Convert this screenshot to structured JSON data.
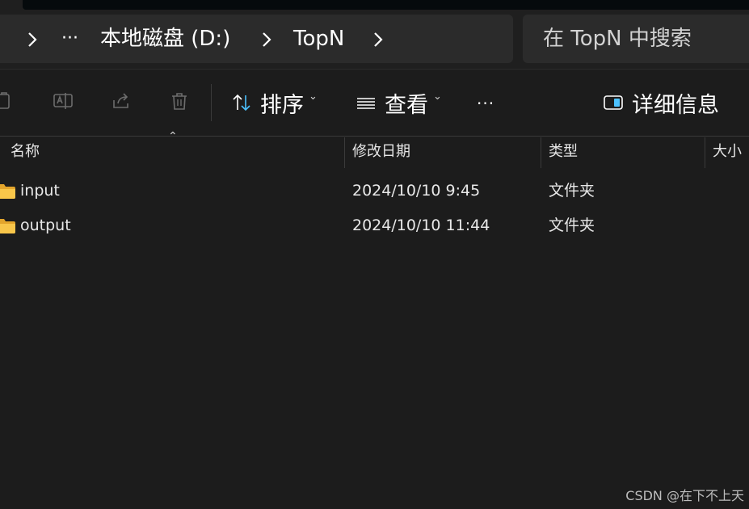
{
  "breadcrumb": {
    "overflow": "···",
    "items": [
      "本地磁盘 (D:)",
      "TopN"
    ]
  },
  "search": {
    "placeholder": "在 TopN 中搜索"
  },
  "command_bar": {
    "copy_icon": "copy-icon",
    "rename_icon": "rename-icon",
    "share_icon": "share-icon",
    "delete_icon": "trash-icon",
    "sort_label": "排序",
    "view_label": "查看",
    "more_label": "···",
    "details_label": "详细信息"
  },
  "columns": {
    "name": "名称",
    "modified": "修改日期",
    "type": "类型",
    "size": "大小"
  },
  "rows": [
    {
      "name": "input",
      "modified": "2024/10/10 9:45",
      "type": "文件夹",
      "size": ""
    },
    {
      "name": "output",
      "modified": "2024/10/10 11:44",
      "type": "文件夹",
      "size": ""
    }
  ],
  "watermark": "CSDN @在下不上天",
  "colors": {
    "background": "#1c1c1c",
    "panel": "#2b2b2b",
    "accent": "#4cc2ff",
    "folder": "#f8c64a"
  }
}
